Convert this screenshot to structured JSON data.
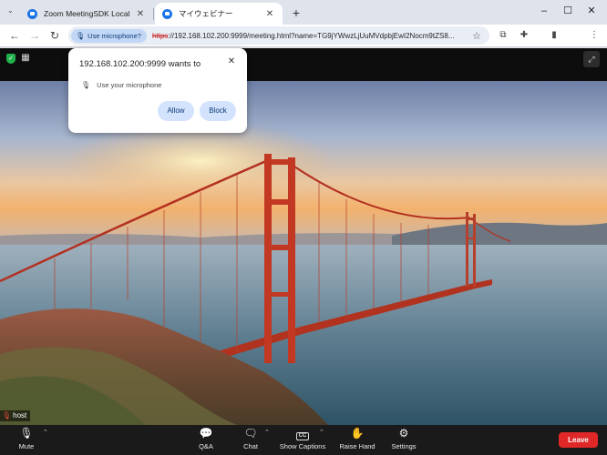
{
  "browser": {
    "tabs": [
      {
        "title": "Zoom MeetingSDK Local",
        "active": false
      },
      {
        "title": "マイウェビナー",
        "active": true
      }
    ],
    "new_tab_symbol": "+",
    "url_scheme": "https",
    "url_rest": "://192.168.102.200:9999/meeting.html?name=TG9jYWwzLjUuMVdpbjEwI2Nocm9tZS8...",
    "permission_chip": "Use microphone?"
  },
  "popup": {
    "title": "192.168.102.200:9999 wants to",
    "permission": "Use your microphone",
    "allow_label": "Allow",
    "block_label": "Block"
  },
  "video": {
    "participant_name": "host"
  },
  "controls": {
    "mute": "Mute",
    "qa": "Q&A",
    "chat": "Chat",
    "captions": "Show Captions",
    "captions_badge": "CC",
    "raise_hand": "Raise Hand",
    "settings": "Settings",
    "leave": "Leave"
  },
  "colors": {
    "leave_button": "#e02828",
    "url_scheme_insecure": "#c5221f",
    "security_shield": "#22b14c"
  }
}
